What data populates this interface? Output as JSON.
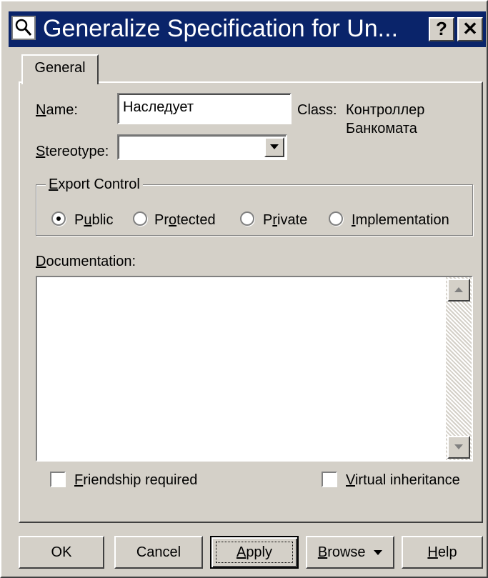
{
  "window": {
    "title": "Generalize Specification for Un...",
    "help_button": "?",
    "close_button": "✕"
  },
  "tabs": [
    {
      "label": "General",
      "active": true
    }
  ],
  "form": {
    "name_label_prefix": "N",
    "name_label_rest": "ame:",
    "name_value": "Наследует",
    "class_label": "Class:",
    "class_value_line1": "Контроллер",
    "class_value_line2": "Банкомата",
    "stereotype_label_prefix": "S",
    "stereotype_label_rest": "tereotype:",
    "stereotype_value": ""
  },
  "export_control": {
    "title_prefix": "E",
    "title_rest": "xport Control",
    "options": [
      {
        "pre": "P",
        "u": "u",
        "post": "blic",
        "selected": true
      },
      {
        "pre": "Pr",
        "u": "o",
        "post": "tected",
        "selected": false
      },
      {
        "pre": "P",
        "u": "r",
        "post": "ivate",
        "selected": false
      },
      {
        "pre": "",
        "u": "I",
        "post": "mplementation",
        "selected": false
      }
    ]
  },
  "documentation": {
    "label_prefix": "D",
    "label_rest": "ocumentation:",
    "value": ""
  },
  "checkboxes": {
    "friendship": {
      "prefix": "F",
      "rest": "riendship required",
      "checked": false
    },
    "virtual": {
      "prefix": "V",
      "rest": "irtual inheritance",
      "checked": false
    }
  },
  "buttons": {
    "ok": "OK",
    "cancel": "Cancel",
    "apply_prefix": "A",
    "apply_rest": "pply",
    "browse_prefix": "B",
    "browse_rest": "rowse",
    "help_prefix": "H",
    "help_rest": "elp"
  },
  "colors": {
    "titlebar": "#0a246a",
    "face": "#d4d0c8"
  }
}
